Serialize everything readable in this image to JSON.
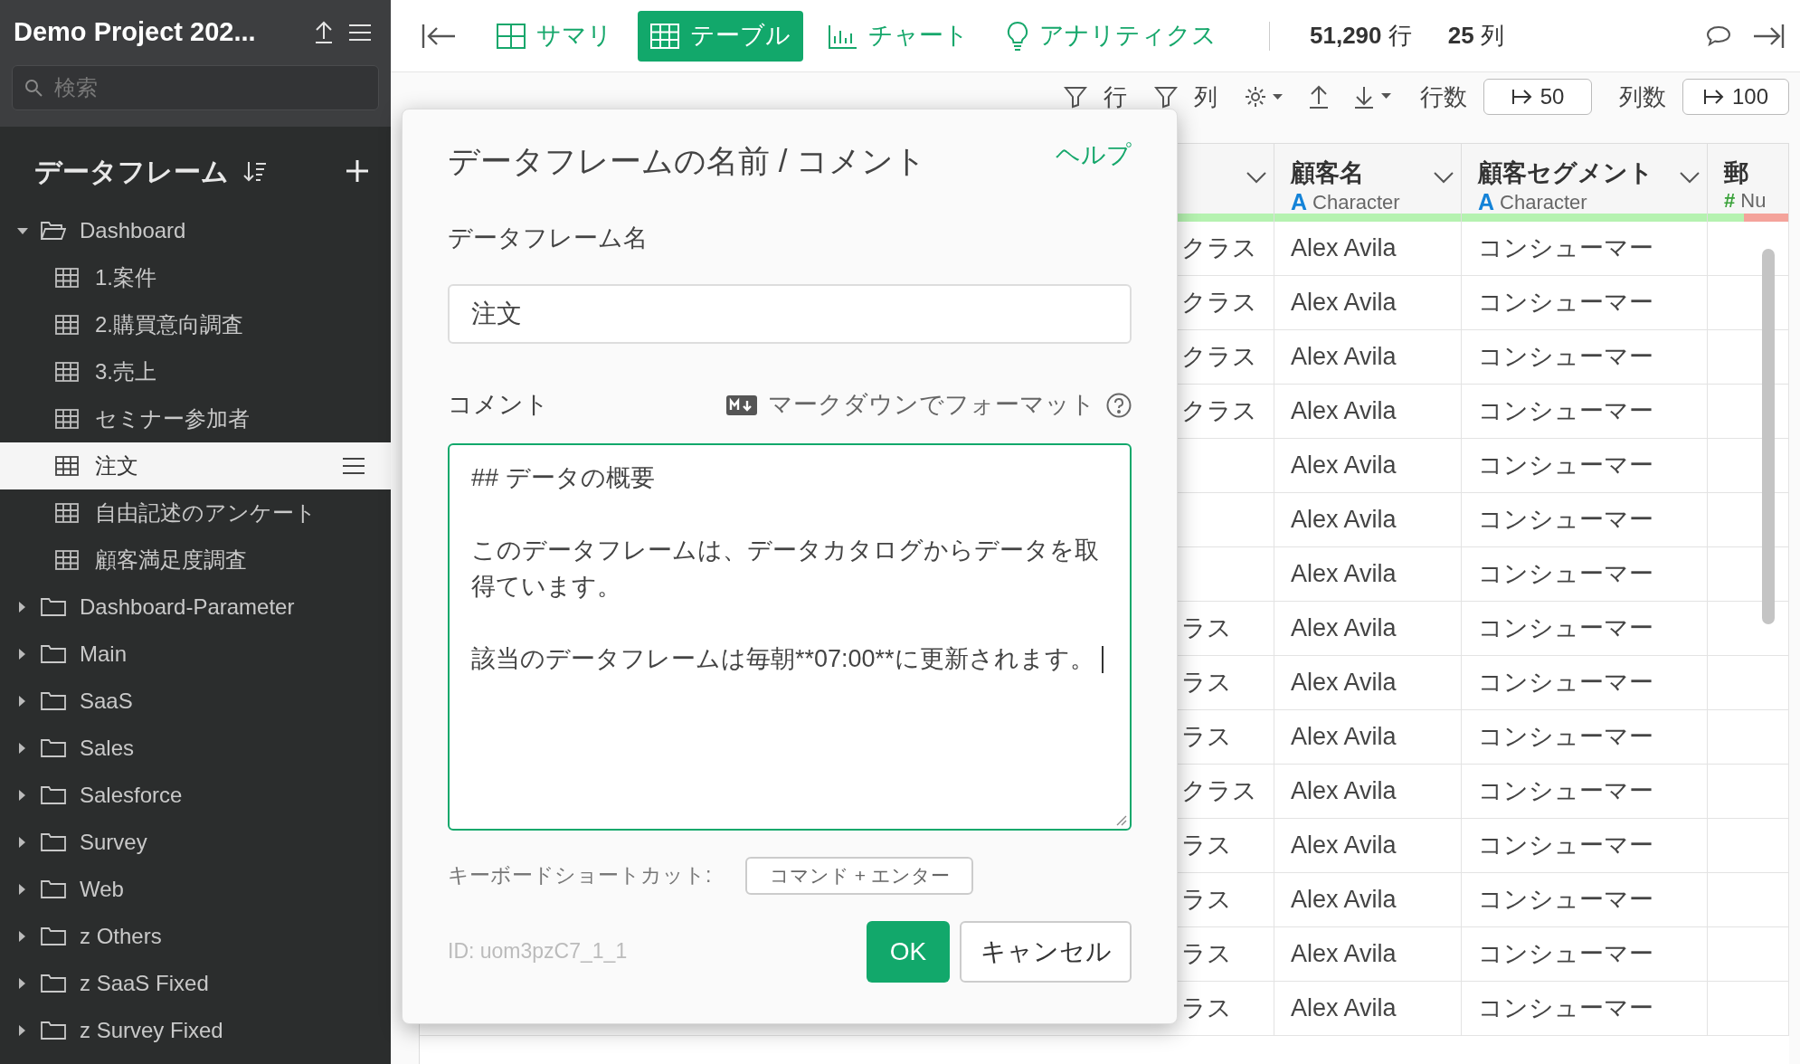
{
  "sidebar": {
    "project_title": "Demo Project 202...",
    "search": {
      "placeholder": "検索"
    },
    "section_title": "データフレーム",
    "tree": [
      {
        "label": "Dashboard",
        "kind": "folder",
        "expanded": true,
        "selected": false,
        "children": [
          {
            "label": "1.案件",
            "kind": "dataframe",
            "selected": false
          },
          {
            "label": "2.購買意向調査",
            "kind": "dataframe",
            "selected": false
          },
          {
            "label": "3.売上",
            "kind": "dataframe",
            "selected": false
          },
          {
            "label": "セミナー参加者",
            "kind": "dataframe",
            "selected": false
          },
          {
            "label": "注文",
            "kind": "dataframe",
            "selected": true
          },
          {
            "label": "自由記述のアンケート",
            "kind": "dataframe",
            "selected": false
          },
          {
            "label": "顧客満足度調査",
            "kind": "dataframe",
            "selected": false
          }
        ]
      },
      {
        "label": "Dashboard-Parameter",
        "kind": "folder",
        "expanded": false,
        "selected": false
      },
      {
        "label": "Main",
        "kind": "folder",
        "expanded": false,
        "selected": false
      },
      {
        "label": "SaaS",
        "kind": "folder",
        "expanded": false,
        "selected": false
      },
      {
        "label": "Sales",
        "kind": "folder",
        "expanded": false,
        "selected": false
      },
      {
        "label": "Salesforce",
        "kind": "folder",
        "expanded": false,
        "selected": false
      },
      {
        "label": "Survey",
        "kind": "folder",
        "expanded": false,
        "selected": false
      },
      {
        "label": "Web",
        "kind": "folder",
        "expanded": false,
        "selected": false
      },
      {
        "label": "z Others",
        "kind": "folder",
        "expanded": false,
        "selected": false
      },
      {
        "label": "z SaaS Fixed",
        "kind": "folder",
        "expanded": false,
        "selected": false
      },
      {
        "label": "z Survey Fixed",
        "kind": "folder",
        "expanded": false,
        "selected": false
      }
    ]
  },
  "tabs": [
    {
      "label": "サマリ",
      "kind": "summary",
      "selected": false
    },
    {
      "label": "テーブル",
      "kind": "table",
      "selected": true
    },
    {
      "label": "チャート",
      "kind": "chart",
      "selected": false
    },
    {
      "label": "アナリティクス",
      "kind": "analytics",
      "selected": false
    }
  ],
  "stats": [
    "**51,290** 行",
    "**25** 列"
  ],
  "toolbar": {
    "row_filter": "行",
    "column_filter": "列",
    "row_count_label": "行数",
    "row_count": "50",
    "column_count_label": "列数",
    "column_count": "100"
  },
  "table": {
    "columns": [
      {
        "level": 1
      },
      {
        "title": "顧客名",
        "type_symbol": "A",
        "type": "Character",
        "level": 1
      },
      {
        "title": "顧客セグメント",
        "type_symbol": "A",
        "type": "Character",
        "level": 1
      },
      {
        "title": "郵",
        "type_symbol": "#",
        "type": "Nu",
        "level": 0.45
      }
    ],
    "rows": [
      {
        "cells": [
          "クラス",
          "Alex Avila",
          "コンシューマー"
        ]
      },
      {
        "cells": [
          "クラス",
          "Alex Avila",
          "コンシューマー"
        ]
      },
      {
        "cells": [
          "クラス",
          "Alex Avila",
          "コンシューマー"
        ]
      },
      {
        "cells": [
          "クラス",
          "Alex Avila",
          "コンシューマー"
        ]
      },
      {
        "cells": [
          "",
          "Alex Avila",
          "コンシューマー"
        ]
      },
      {
        "cells": [
          "",
          "Alex Avila",
          "コンシューマー"
        ]
      },
      {
        "cells": [
          "",
          "Alex Avila",
          "コンシューマー"
        ]
      },
      {
        "cells": [
          "ラス",
          "Alex Avila",
          "コンシューマー"
        ]
      },
      {
        "cells": [
          "ラス",
          "Alex Avila",
          "コンシューマー"
        ]
      },
      {
        "cells": [
          "ラス",
          "Alex Avila",
          "コンシューマー"
        ]
      },
      {
        "cells": [
          "クラス",
          "Alex Avila",
          "コンシューマー"
        ]
      },
      {
        "cells": [
          "ラス",
          "Alex Avila",
          "コンシューマー"
        ]
      },
      {
        "cells": [
          "ラス",
          "Alex Avila",
          "コンシューマー"
        ]
      },
      {
        "cells": [
          "ラス",
          "Alex Avila",
          "コンシューマー"
        ]
      },
      {
        "cells": [
          "ラス",
          "Alex Avila",
          "コンシューマー"
        ]
      }
    ]
  },
  "dialog": {
    "title": "データフレームの名前 / コメント",
    "help": "ヘルプ",
    "name_label": "データフレーム名",
    "name_value": "注文",
    "comment_label": "コメント",
    "markdown_hint": "マークダウンでフォーマット",
    "comment": [
      "## データの概要",
      "このデータフレームは、データカタログからデータを取得ています。",
      "該当のデータフレームは毎朝**07:00**に更新されます。"
    ],
    "comment_focused": true,
    "shortcut_label": "キーボードショートカット:",
    "shortcut_key": "コマンド + エンター",
    "id": "ID: uom3pzC7_1_1",
    "ok": "OK",
    "cancel": "キャンセル"
  }
}
